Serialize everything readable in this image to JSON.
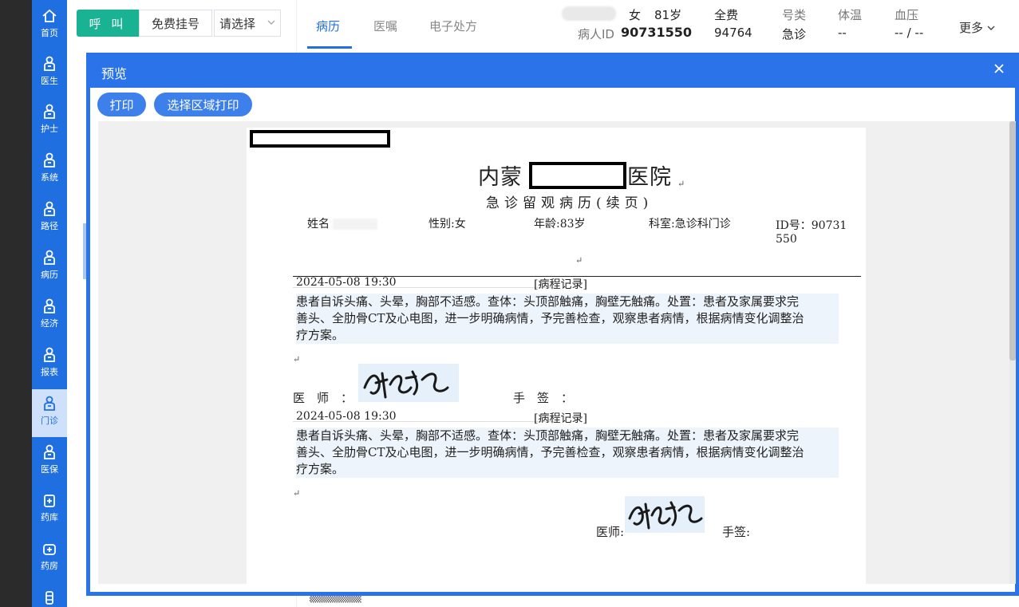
{
  "sidebar": {
    "items": [
      {
        "label": "首页",
        "icon": "home-icon"
      },
      {
        "label": "医生",
        "icon": "doctor-icon"
      },
      {
        "label": "护士",
        "icon": "nurse-icon"
      },
      {
        "label": "系统",
        "icon": "system-icon"
      },
      {
        "label": "路径",
        "icon": "path-icon"
      },
      {
        "label": "病历",
        "icon": "record-icon"
      },
      {
        "label": "经济",
        "icon": "economy-icon"
      },
      {
        "label": "报表",
        "icon": "report-icon"
      },
      {
        "label": "门诊",
        "icon": "outpatient-icon"
      },
      {
        "label": "医保",
        "icon": "insurance-icon"
      },
      {
        "label": "药库",
        "icon": "pharmacy-store-icon"
      },
      {
        "label": "药房",
        "icon": "pharmacy-icon"
      },
      {
        "label": "",
        "icon": "bottle-icon"
      }
    ]
  },
  "toolbar": {
    "call_label": "呼 叫",
    "register_label": "免费挂号",
    "select_placeholder": "请选择"
  },
  "tabs": [
    {
      "label": "病历"
    },
    {
      "label": "医嘱"
    },
    {
      "label": "电子处方"
    }
  ],
  "patient": {
    "gender": "女",
    "age": "81岁",
    "id_label": "病人ID",
    "id_value": "90731550",
    "fee_type": "全费",
    "fee_number": "94764",
    "reg_type_label": "号类",
    "reg_type_value": "急诊",
    "temp_label": "体温",
    "temp_value": "--",
    "bp_label": "血压",
    "bp_value": "-- / --",
    "more_label": "更多"
  },
  "dialog": {
    "title": "预览",
    "print_label": "打印",
    "print_area_label": "选择区域打印"
  },
  "document": {
    "hospital_prefix": "内蒙",
    "hospital_suffix": "医院",
    "subtitle": "急诊留观病历(续页)",
    "name_label": "姓名",
    "gender_field": "性别:女",
    "age_field": "年龄:83岁",
    "dept_field": "科室:急诊科门诊",
    "id_field_line1": "ID号：90731",
    "id_field_line2": "550",
    "records": [
      {
        "time": "2024-05-08 19:30",
        "tag": "[病程记录]",
        "lines": [
          "患者自诉头痛、头晕，胸部不适感。查体：头顶部触痛，胸壁无触痛。处置：患者及家属要求完",
          "善头、全肋骨CT及心电图，进一步明确病情，予完善检查，观察患者病情，根据病情变化调整治",
          "疗方案。"
        ],
        "doctor_label": "医　师　：",
        "sign_label": "手　签　："
      },
      {
        "time": "2024-05-08 19:30",
        "tag": "[病程记录]",
        "lines": [
          "患者自诉头痛、头晕，胸部不适感。查体：头顶部触痛，胸壁无触痛。处置：患者及家属要求完",
          "善头、全肋骨CT及心电图，进一步明确病情，予完善检查，观察患者病情，根据病情变化调整治",
          "疗方案。"
        ],
        "doctor_label": "医师:",
        "sign_label": "手签:"
      }
    ]
  },
  "colors": {
    "sidebar": "#1f6fe0",
    "dialog_header": "#2a73e8",
    "call_button": "#19b394",
    "toolbar_button": "#3d80ec"
  }
}
